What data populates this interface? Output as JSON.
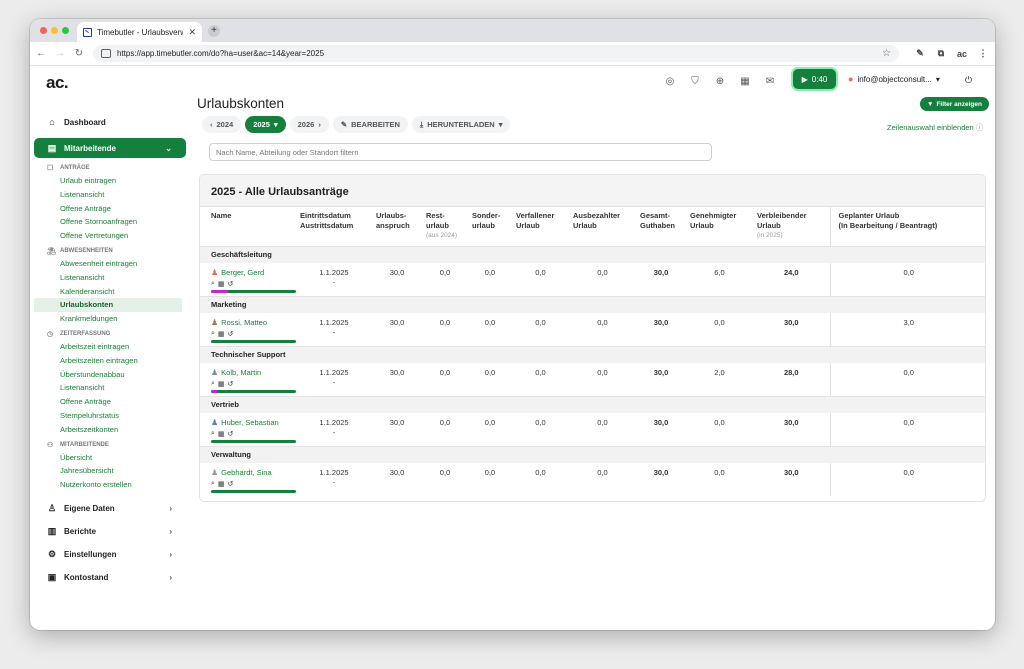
{
  "browser": {
    "tab_title": "Timebutler - Urlaubsverwaltu...",
    "url": "https://app.timebutler.com/do?ha=user&ac=14&year=2025"
  },
  "header": {
    "logo": "ac.",
    "timer": "0:40",
    "user": "info@objectconsult..."
  },
  "sidebar": {
    "dashboard": "Dashboard",
    "mitarbeitende": "Mitarbeitende",
    "sections": [
      {
        "title": "ANTRÄGE",
        "items": [
          "Urlaub eintragen",
          "Listenansicht",
          "Offene Anträge",
          "Offene Stornoanfragen",
          "Offene Vertretungen"
        ]
      },
      {
        "title": "ABWESENHEITEN",
        "items": [
          "Abwesenheit eintragen",
          "Listenansicht",
          "Kalenderansicht",
          "Urlaubskonten",
          "Krankmeldungen"
        ]
      },
      {
        "title": "ZEITERFASSUNG",
        "items": [
          "Arbeitszeit eintragen",
          "Arbeitszeiten eintragen",
          "Überstundenabbau",
          "Listenansicht",
          "Offene Anträge",
          "Stempeluhrstatus",
          "Arbeitszeitkonten"
        ]
      },
      {
        "title": "MITARBEITENDE",
        "items": [
          "Übersicht",
          "Jahresübersicht",
          "Nutzerkonto erstellen"
        ]
      }
    ],
    "bottom": [
      "Eigene Daten",
      "Berichte",
      "Einstellungen",
      "Kontostand"
    ]
  },
  "main": {
    "title": "Urlaubskonten",
    "year_prev": "2024",
    "year_current": "2025",
    "year_next": "2026",
    "edit": "BEARBEITEN",
    "download": "HERUNTERLADEN",
    "filter_button": "Filter anzeigen",
    "row_toggle": "Zeilenauswahl einblenden",
    "search_placeholder": "Nach Name, Abteilung oder Standort filtern",
    "card_title": "2025 - Alle Urlaubsanträge"
  },
  "table": {
    "headers": {
      "name": "Name",
      "dates1": "Eintrittsdatum",
      "dates2": "Austrittsdatum",
      "anspruch1": "Urlaubs-",
      "anspruch2": "anspruch",
      "rest1": "Rest-",
      "rest2": "urlaub",
      "rest_sub": "(aus 2024)",
      "sonder1": "Sonder-",
      "sonder2": "urlaub",
      "verfallen1": "Verfallener",
      "verfallen2": "Urlaub",
      "ausbezahlt1": "Ausbezahlter",
      "ausbezahlt2": "Urlaub",
      "gesamt1": "Gesamt-",
      "gesamt2": "Guthaben",
      "genehmigt1": "Genehmigter",
      "genehmigt2": "Urlaub",
      "verbleibend1": "Verbleibender",
      "verbleibend2": "Urlaub",
      "verbleibend_sub": "(in 2025)",
      "geplant1": "Geplanter Urlaub",
      "geplant2": "(In Bearbeitung / Beantragt)"
    },
    "groups": [
      {
        "name": "Geschäftsleitung",
        "employee": {
          "name": "Berger, Gerd",
          "entry": "1.1.2025",
          "exit": "-",
          "anspruch": "30,0",
          "rest": "0,0",
          "sonder": "0,0",
          "verfallen": "0,0",
          "ausbezahlt": "0,0",
          "gesamt": "30,0",
          "genehmigt": "6,0",
          "verbleibend": "24,0",
          "geplant": "0,0",
          "used_pct": 20,
          "avatar_color": "#ea6a5a"
        }
      },
      {
        "name": "Marketing",
        "employee": {
          "name": "Rossi, Matteo",
          "entry": "1.1.2025",
          "exit": "-",
          "anspruch": "30,0",
          "rest": "0,0",
          "sonder": "0,0",
          "verfallen": "0,0",
          "ausbezahlt": "0,0",
          "gesamt": "30,0",
          "genehmigt": "0,0",
          "verbleibend": "30,0",
          "geplant": "3,0",
          "used_pct": 0,
          "avatar_color": "#a07855"
        }
      },
      {
        "name": "Technischer Support",
        "employee": {
          "name": "Kolb, Martin",
          "entry": "1.1.2025",
          "exit": "-",
          "anspruch": "30,0",
          "rest": "0,0",
          "sonder": "0,0",
          "verfallen": "0,0",
          "ausbezahlt": "0,0",
          "gesamt": "30,0",
          "genehmigt": "2,0",
          "verbleibend": "28,0",
          "geplant": "0,0",
          "used_pct": 7,
          "avatar_color": "#888888"
        }
      },
      {
        "name": "Vertrieb",
        "employee": {
          "name": "Huber, Sebastian",
          "entry": "1.1.2025",
          "exit": "-",
          "anspruch": "30,0",
          "rest": "0,0",
          "sonder": "0,0",
          "verfallen": "0,0",
          "ausbezahlt": "0,0",
          "gesamt": "30,0",
          "genehmigt": "0,0",
          "verbleibend": "30,0",
          "geplant": "0,0",
          "used_pct": 0,
          "avatar_color": "#5b7bb5"
        }
      },
      {
        "name": "Verwaltung",
        "employee": {
          "name": "Gebhardt, Sina",
          "entry": "1.1.2025",
          "exit": "-",
          "anspruch": "30,0",
          "rest": "0,0",
          "sonder": "0,0",
          "verfallen": "0,0",
          "ausbezahlt": "0,0",
          "gesamt": "30,0",
          "genehmigt": "0,0",
          "verbleibend": "30,0",
          "geplant": "0,0",
          "used_pct": 0,
          "avatar_color": "#9a9a9a"
        }
      }
    ]
  }
}
